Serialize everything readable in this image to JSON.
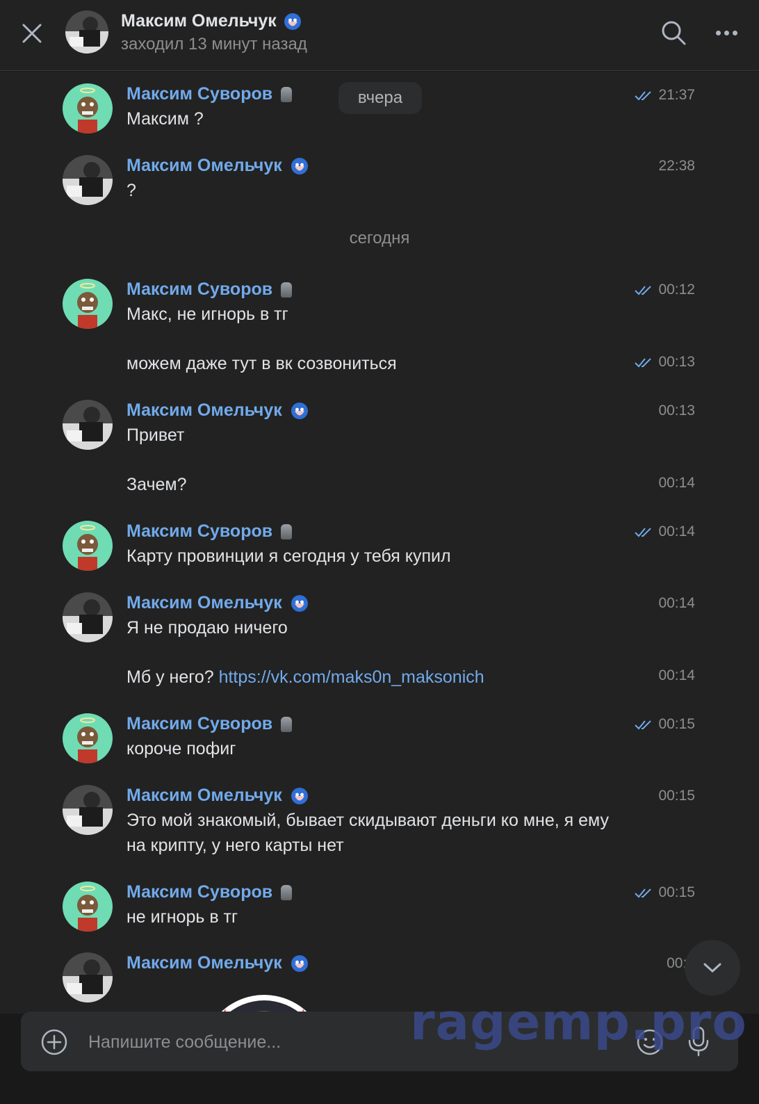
{
  "header": {
    "name": "Максим Омельчук",
    "status": "заходил 13 минут назад"
  },
  "dates": {
    "yesterday": "вчера",
    "today": "сегодня"
  },
  "messages": [
    {
      "author": "Максим Суворов",
      "text": "Максим ?",
      "time": "21:37",
      "read": true
    },
    {
      "author": "Максим Омельчук",
      "text": "?",
      "time": "22:38"
    },
    {
      "author": "Максим Суворов",
      "text": "Макс, не игнорь в тг",
      "time": "00:12",
      "read": true
    },
    {
      "text": "можем даже тут в вк созвониться",
      "time": "00:13",
      "read": true
    },
    {
      "author": "Максим Омельчук",
      "text": "Привет",
      "time": "00:13"
    },
    {
      "text": "Зачем?",
      "time": "00:14"
    },
    {
      "author": "Максим Суворов",
      "text": "Карту провинции я сегодня у тебя купил",
      "time": "00:14",
      "read": true
    },
    {
      "author": "Максим Омельчук",
      "text": "Я не продаю ничего",
      "time": "00:14"
    },
    {
      "text": "Мб у него?",
      "link": "https://vk.com/maks0n_maksonich",
      "time": "00:14"
    },
    {
      "author": "Максим Суворов",
      "text": "короче пофиг",
      "time": "00:15",
      "read": true
    },
    {
      "author": "Максим Омельчук",
      "text": "Это мой знакомый, бывает скидывают деньги ко мне, я ему на крипту, у него карты нет",
      "time": "00:15"
    },
    {
      "author": "Максим Суворов",
      "text": "не игнорь в тг",
      "time": "00:15",
      "read": true
    },
    {
      "author": "Максим Омельчук",
      "time": "00:1"
    }
  ],
  "composer": {
    "placeholder": "Напишите сообщение..."
  },
  "watermark": "ragemp.pro",
  "colors": {
    "background": "#222222",
    "accent": "#71aaeb",
    "text": "#e1e3e6",
    "muted": "#8c8e91"
  },
  "icons": [
    "close-icon",
    "search-icon",
    "more-icon",
    "check-icon",
    "chevron-down-icon",
    "plus-icon",
    "smile-icon",
    "mic-icon"
  ]
}
